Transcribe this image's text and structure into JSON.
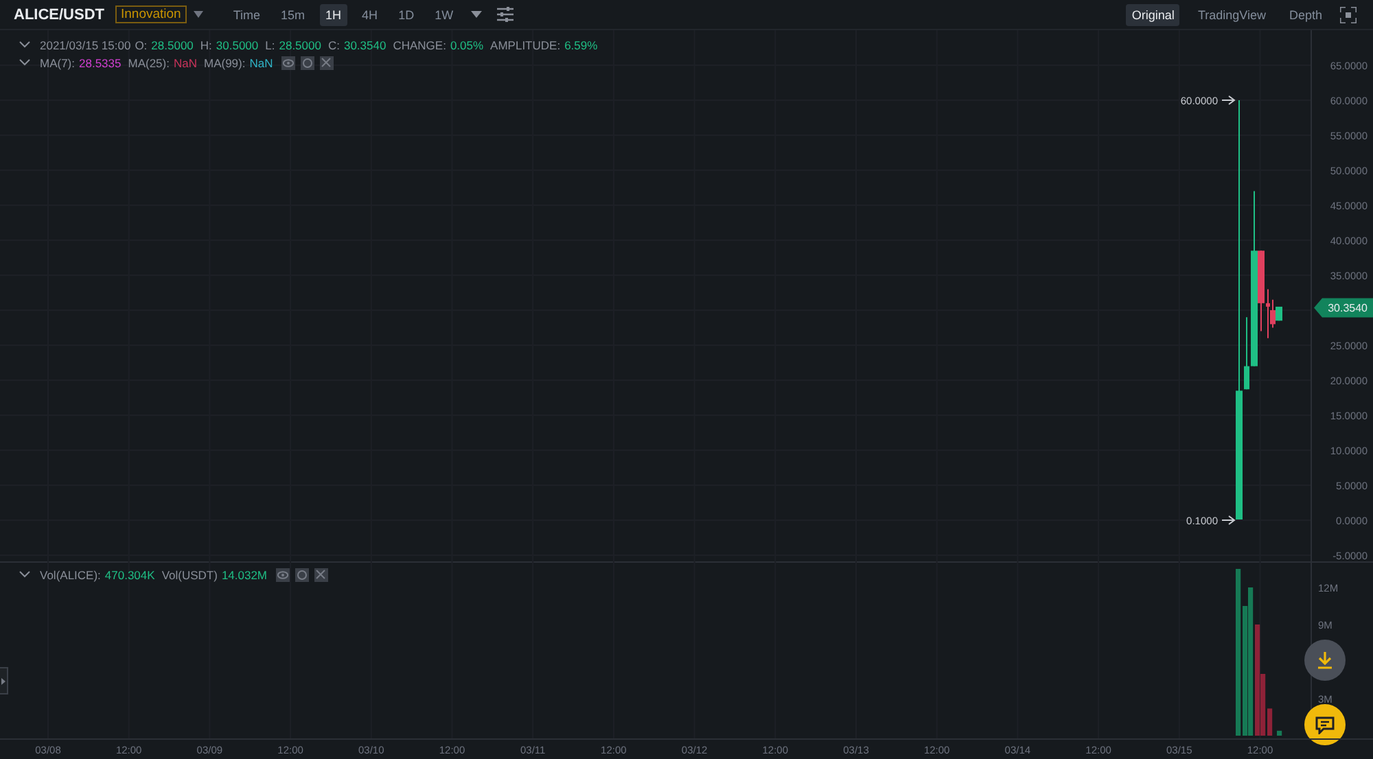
{
  "header": {
    "symbol": "ALICE/USDT",
    "tag": "Innovation",
    "intervals": [
      {
        "label": "Time",
        "selected": false
      },
      {
        "label": "15m",
        "selected": false
      },
      {
        "label": "1H",
        "selected": true
      },
      {
        "label": "4H",
        "selected": false
      },
      {
        "label": "1D",
        "selected": false
      },
      {
        "label": "1W",
        "selected": false
      }
    ],
    "views": [
      {
        "label": "Original",
        "selected": true
      },
      {
        "label": "TradingView",
        "selected": false
      },
      {
        "label": "Depth",
        "selected": false
      }
    ]
  },
  "legend": {
    "date": "2021/03/15 15:00",
    "fields": [
      {
        "label": "O:",
        "value": "28.5000"
      },
      {
        "label": "H:",
        "value": "30.5000"
      },
      {
        "label": "L:",
        "value": "28.5000"
      },
      {
        "label": "C:",
        "value": "30.3540"
      },
      {
        "label": "CHANGE:",
        "value": "0.05%"
      },
      {
        "label": "AMPLITUDE:",
        "value": "6.59%"
      }
    ],
    "ma": [
      {
        "label": "MA(7):",
        "value": "28.5335",
        "color": "#d23fd2"
      },
      {
        "label": "MA(25):",
        "value": "NaN",
        "color": "#c8335a"
      },
      {
        "label": "MA(99):",
        "value": "NaN",
        "color": "#2fb3c6"
      }
    ]
  },
  "price_axis": [
    "65.0000",
    "60.0000",
    "55.0000",
    "50.0000",
    "45.0000",
    "40.0000",
    "35.0000",
    "25.0000",
    "20.0000",
    "15.0000",
    "10.0000",
    "5.0000",
    "0.0000",
    "-5.0000"
  ],
  "annotations": {
    "high": "60.0000",
    "low": "0.1000",
    "last_price": "30.3540"
  },
  "volume": {
    "fields": [
      {
        "label": "Vol(ALICE):",
        "value": "470.304K"
      },
      {
        "label": "Vol(USDT)",
        "value": "14.032M"
      }
    ],
    "axis": [
      "12M",
      "9M",
      "3M"
    ]
  },
  "time_axis": [
    "03/08",
    "12:00",
    "03/09",
    "12:00",
    "03/10",
    "12:00",
    "03/11",
    "12:00",
    "03/12",
    "12:00",
    "03/13",
    "12:00",
    "03/14",
    "12:00",
    "03/15",
    "12:00"
  ]
}
